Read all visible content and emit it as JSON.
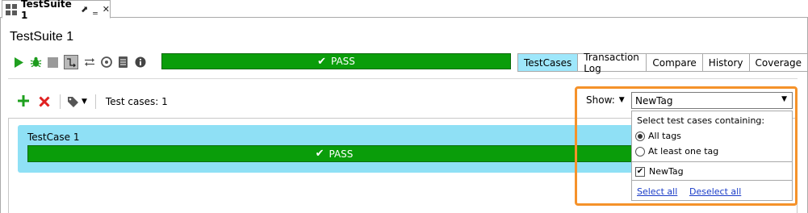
{
  "document_tab": {
    "title": "TestSuite 1",
    "pin_glyph": "⬈",
    "minimize_glyph": "‗",
    "close_glyph": "✕"
  },
  "suite": {
    "title": "TestSuite 1",
    "status": "PASS"
  },
  "toolbar_icons": [
    "run-icon",
    "debug-icon",
    "stop-icon",
    "step-icon",
    "redirect-icon",
    "clock-icon",
    "log-icon",
    "info-icon"
  ],
  "view_tabs": [
    {
      "label": "TestCases",
      "active": true
    },
    {
      "label": "Transaction Log",
      "active": false
    },
    {
      "label": "Compare",
      "active": false
    },
    {
      "label": "History",
      "active": false
    },
    {
      "label": "Coverage",
      "active": false
    }
  ],
  "case_toolbar": {
    "count_label": "Test cases: 1"
  },
  "filter": {
    "show_label": "Show:",
    "selected": "NewTag",
    "heading": "Select test cases containing:",
    "options": [
      {
        "label": "All tags",
        "selected": true
      },
      {
        "label": "At least one tag",
        "selected": false
      }
    ],
    "tags": [
      {
        "label": "NewTag",
        "checked": true
      }
    ],
    "select_all": "Select all",
    "deselect_all": "Deselect all"
  },
  "test_cases": [
    {
      "name": "TestCase 1",
      "status": "PASS"
    }
  ],
  "colors": {
    "pass_green": "#0a9d0a",
    "active_tab": "#9ee7fb",
    "highlight_orange": "#f5922a",
    "card_blue": "#8fe0f5"
  }
}
